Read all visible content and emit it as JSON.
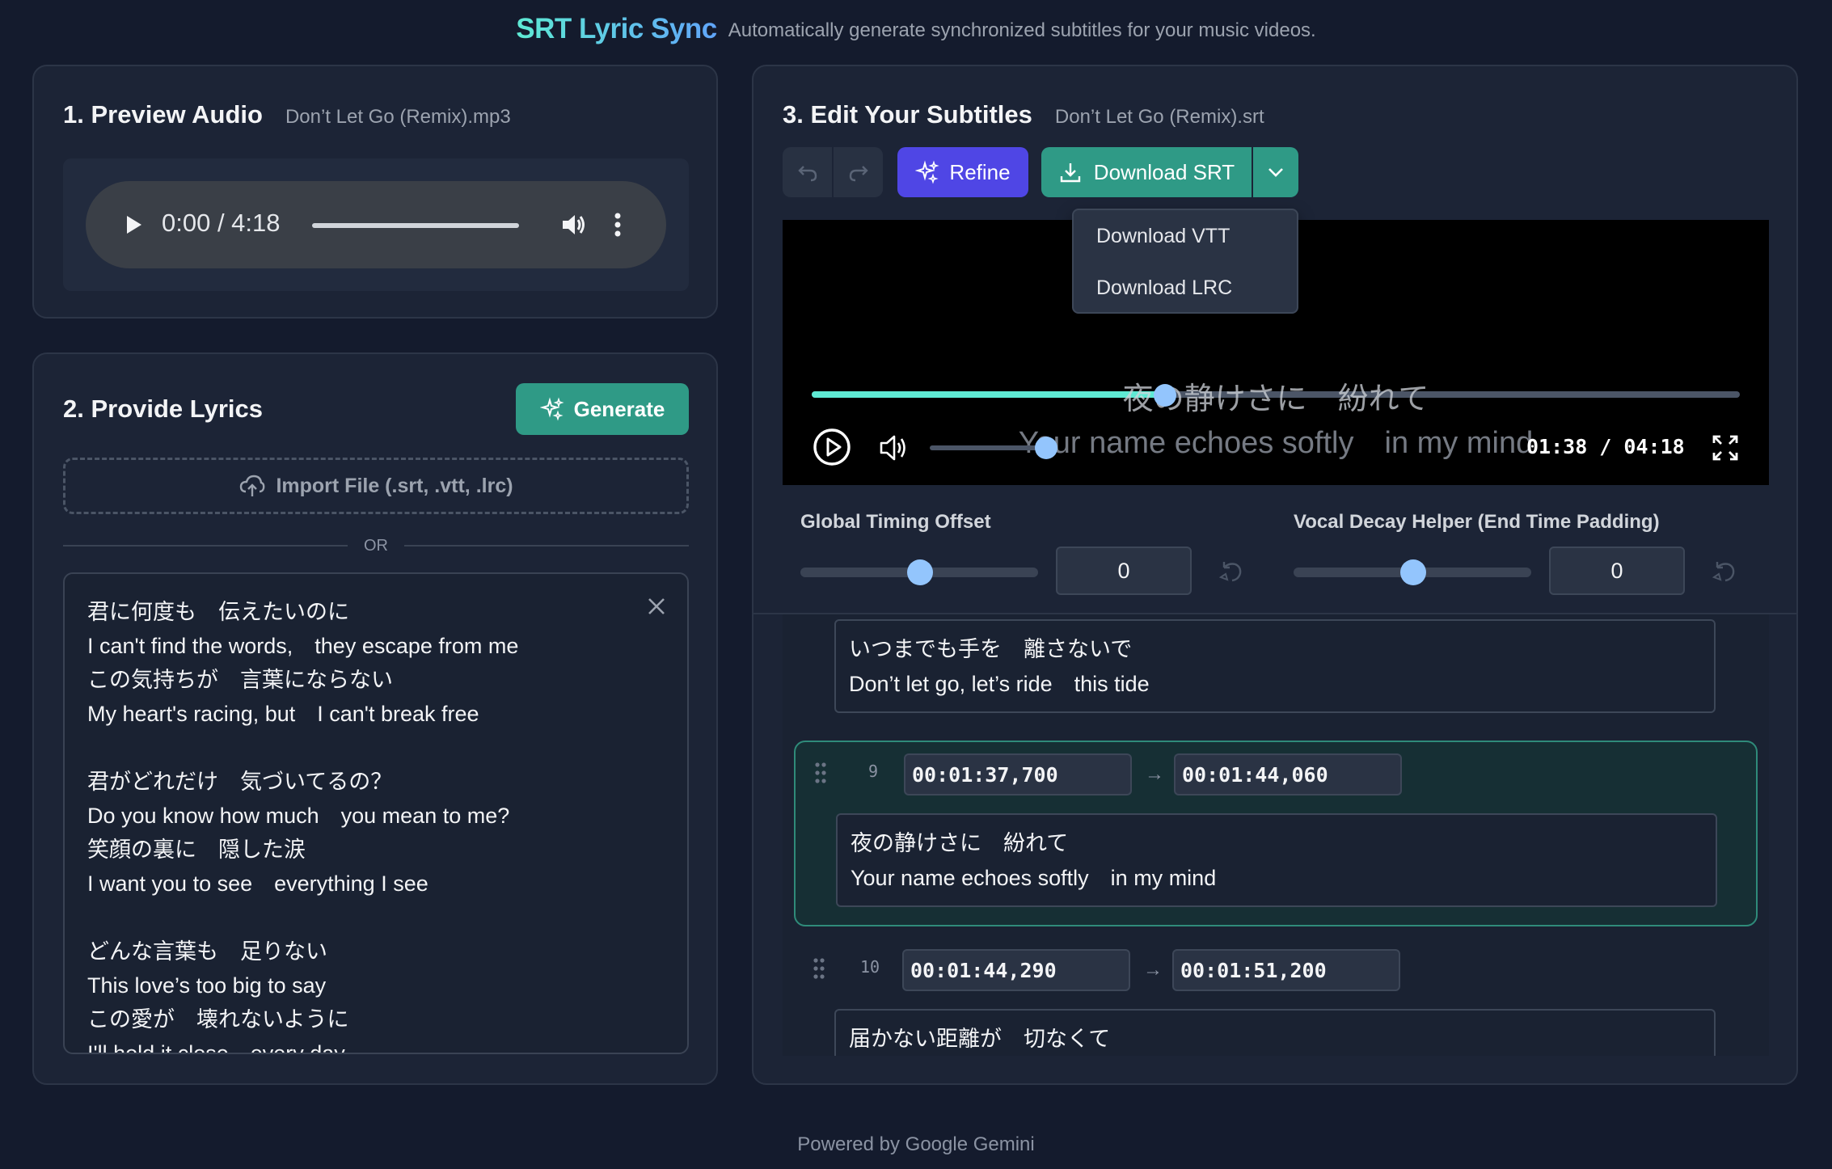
{
  "header": {
    "brand": "SRT Lyric Sync",
    "tagline": "Automatically generate synchronized subtitles for your music videos."
  },
  "preview": {
    "title": "1. Preview Audio",
    "filename": "Don’t Let Go (Remix).mp3",
    "time": "0:00 / 4:18"
  },
  "lyrics_panel": {
    "title": "2. Provide Lyrics",
    "generate_label": "Generate",
    "import_label": "Import File (.srt, .vtt, .lrc)",
    "or_label": "OR",
    "text": "君に何度も　伝えたいのに\nI can't find the words,　they escape from me\nこの気持ちが　言葉にならない\nMy heart's racing, but　I can't break free\n\n君がどれだけ　気づいてるの？\nDo you know how much　you mean to me?\n笑顔の裏に　隠した涙\nI want you to see　everything I see\n\nどんな言葉も　足りない\nThis love’s  too big to say\nこの愛が　壊れないように\nI'll hold it close　every day"
  },
  "editor": {
    "title": "3. Edit Your Subtitles",
    "filename": "Don’t Let Go (Remix).srt",
    "refine_label": "Refine",
    "download_label": "Download SRT",
    "dropdown": [
      "Download VTT",
      "Download LRC"
    ],
    "video": {
      "subtitle_line1": "夜の静けさに　紛れて",
      "subtitle_line2": "Your name echoes softly　in my mind",
      "time": "01:38 / 04:18",
      "progress": 0.381,
      "volume": 0.85
    },
    "timing": {
      "offset_label": "Global Timing Offset",
      "offset_value": "0",
      "decay_label": "Vocal Decay Helper (End Time Padding)",
      "decay_value": "0"
    },
    "cues": [
      {
        "text": "いつまでも手を　離さないで\nDon’t let go, let’s ride　this tide"
      },
      {
        "number": "9",
        "start": "00:01:37,700",
        "end": "00:01:44,060",
        "text": "夜の静けさに　紛れて\nYour name echoes softly　in my mind"
      },
      {
        "number": "10",
        "start": "00:01:44,290",
        "end": "00:01:51,200",
        "text": "届かない距離が　切なくて"
      }
    ]
  },
  "footer": "Powered by Google Gemini",
  "colors": {
    "accent_teal": "#2f9a86",
    "accent_indigo": "#4f46e5",
    "background": "#141b2d"
  }
}
